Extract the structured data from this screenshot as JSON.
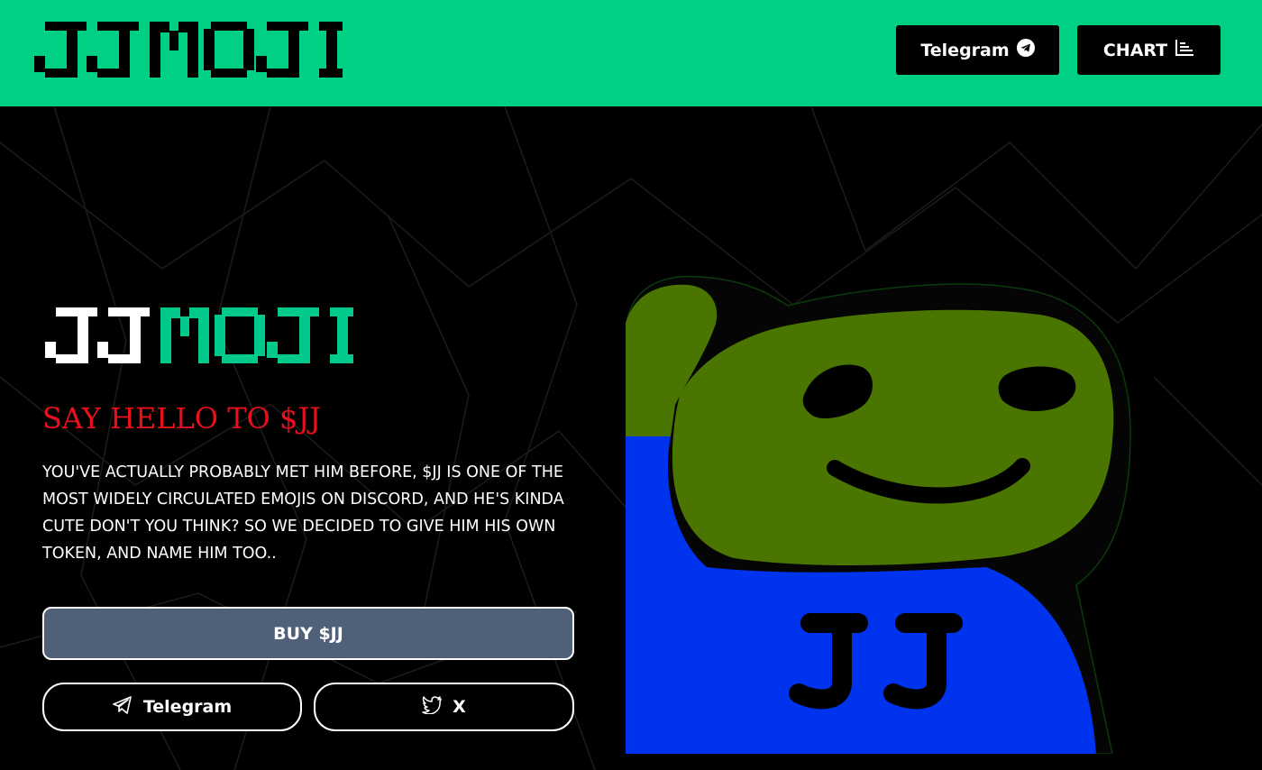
{
  "brand": {
    "logo_text_top": "JJMOJI",
    "logo_text_hero_part1": "JJ",
    "logo_text_hero_part2": "MOJI"
  },
  "nav": {
    "telegram_label": "Telegram",
    "chart_label": "CHART"
  },
  "hero": {
    "tagline": "SAY HELLO TO $JJ",
    "description": "YOU'VE ACTUALLY PROBABLY MET HIM BEFORE, $JJ IS ONE OF THE MOST WIDELY CIRCULATED EMOJIS ON DISCORD, AND HE'S KINDA CUTE DON'T YOU THINK? SO WE DECIDED TO GIVE HIM HIS OWN TOKEN, AND NAME HIM TOO..",
    "buy_label": "BUY $JJ",
    "telegram_label": "Telegram",
    "x_label": "X"
  },
  "mascot": {
    "shirt_text": "JJ"
  },
  "colors": {
    "header_bg": "#00d084",
    "accent_green": "#00c98b",
    "tagline_red": "#e8101a",
    "buy_bg": "#4f6078",
    "mascot_face": "#4a7500",
    "mascot_shirt": "#0033ee"
  },
  "icons": {
    "nav_telegram": "telegram-icon",
    "nav_chart": "chart-icon",
    "social_telegram": "paper-plane-icon",
    "social_x": "twitter-bird-icon"
  }
}
